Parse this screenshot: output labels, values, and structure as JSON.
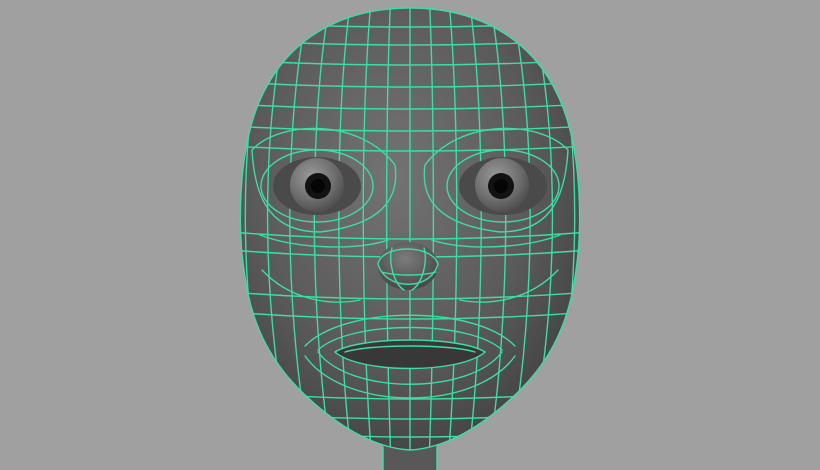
{
  "viewport": {
    "background_color": "#a0a0a0",
    "mesh_surface_color": "#555555",
    "wireframe_color": "#3fdca4",
    "subject": "polygon-head-model-wireframe-on-shaded"
  }
}
